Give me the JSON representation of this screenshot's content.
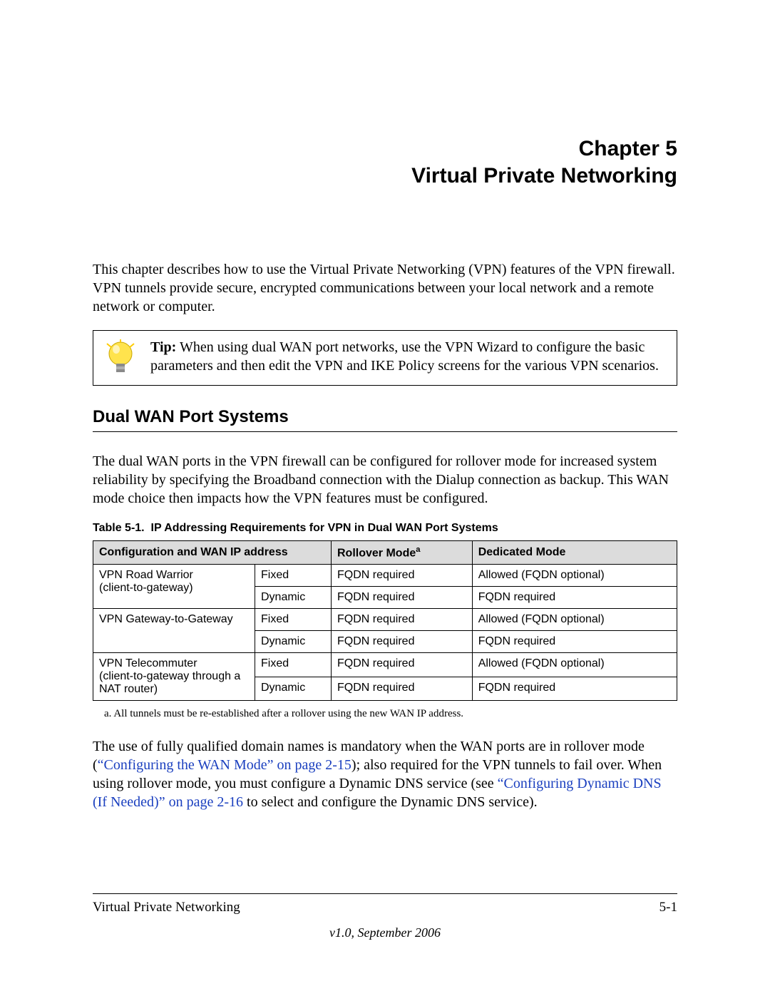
{
  "chapter": {
    "number_line": "Chapter 5",
    "title_line": "Virtual Private Networking"
  },
  "intro_paragraph": "This chapter describes how to use the Virtual Private Networking (VPN) features of the VPN firewall. VPN tunnels provide secure, encrypted communications between your local network and a remote network or computer.",
  "tip": {
    "label": "Tip:",
    "text": " When using dual WAN port networks, use the VPN Wizard to configure the basic parameters and then edit the VPN and IKE Policy screens for the various VPN scenarios."
  },
  "section_heading": "Dual WAN Port Systems",
  "section_paragraph": "The dual WAN ports in the VPN firewall can be configured for rollover mode for increased system reliability by specifying the Broadband connection with the Dialup connection as backup. This WAN mode choice then impacts how the VPN features must be configured.",
  "table": {
    "caption_prefix": "Table 5-1.",
    "caption_text": "IP Addressing Requirements for VPN in Dual WAN Port Systems",
    "headers": {
      "config": "Configuration and WAN IP address",
      "rollover": "Rollover Mode",
      "rollover_sup": "a",
      "dedicated": "Dedicated Mode"
    },
    "groups": [
      {
        "label_line1": "VPN Road Warrior",
        "label_line2": "(client-to-gateway)",
        "rows": [
          {
            "iptype": "Fixed",
            "rollover": "FQDN required",
            "dedicated": "Allowed (FQDN optional)"
          },
          {
            "iptype": "Dynamic",
            "rollover": "FQDN required",
            "dedicated": "FQDN required"
          }
        ]
      },
      {
        "label_line1": "VPN Gateway-to-Gateway",
        "label_line2": "",
        "rows": [
          {
            "iptype": "Fixed",
            "rollover": "FQDN required",
            "dedicated": "Allowed (FQDN optional)"
          },
          {
            "iptype": "Dynamic",
            "rollover": "FQDN required",
            "dedicated": "FQDN required"
          }
        ]
      },
      {
        "label_line1": "VPN Telecommuter",
        "label_line2": "(client-to-gateway through a NAT router)",
        "rows": [
          {
            "iptype": "Fixed",
            "rollover": "FQDN required",
            "dedicated": "Allowed (FQDN optional)"
          },
          {
            "iptype": "Dynamic",
            "rollover": "FQDN required",
            "dedicated": "FQDN required"
          }
        ]
      }
    ],
    "footnote": "a. All tunnels must be re-established after a rollover using the new WAN IP address."
  },
  "closing_paragraph": {
    "t1": "The use of fully qualified domain names is mandatory when the WAN ports are in rollover mode (",
    "link1": "“Configuring the WAN Mode” on page 2-15",
    "t2": "); also required for the VPN tunnels to fail over. When using rollover mode, you must configure a Dynamic DNS service (see ",
    "link2": "“Configuring Dynamic DNS (If Needed)” on page 2-16",
    "t3": " to select and configure the Dynamic DNS service)."
  },
  "footer": {
    "left": "Virtual Private Networking",
    "right": "5-1",
    "version": "v1.0, September 2006"
  }
}
